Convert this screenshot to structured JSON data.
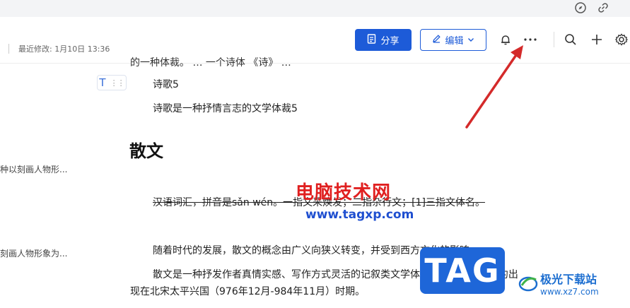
{
  "header": {
    "last_modified": "最近修改: 1月10日 13:36",
    "share_label": "分享",
    "edit_label": "编辑"
  },
  "sidebar": {
    "items": [
      {
        "label": "种以刻画人物形..."
      },
      {
        "label": "刻画人物形象为..."
      }
    ]
  },
  "document": {
    "cut_top_text": "的一种体裁。  …  一个诗体  《诗》  …",
    "block_handle_label": "T",
    "poem_title": "诗歌5",
    "poem_desc": "诗歌是一种抒情言志的文学体裁5",
    "section_heading": "散文",
    "struck_para": "汉语词汇，拼音是sǎn wén。一指文采焕发；二指杂行文；[1]三指文体名。",
    "para_1": "随着时代的发展，散文的概念由广义向狭义转变，并受到西方文化的影响。",
    "para_2": "散文是一种抒发作者真情实感、写作方式灵活的记叙类文学体裁。\"散文\"一词大约出",
    "para_3": "现在北宋太平兴国（976年12月-984年11月）时期。"
  },
  "watermarks": {
    "site_cn": "电脑技术网",
    "site_url": "www.tagxp.com",
    "tag_label": "TAG",
    "logo_name": "极光下载站",
    "logo_url": "www.xz7.com"
  },
  "colors": {
    "accent": "#1d5bd8",
    "annotation_arrow": "#d42a2a"
  },
  "icons": [
    "compass-icon",
    "link-icon",
    "document-icon",
    "pencil-icon",
    "chevron-down-icon",
    "bell-icon",
    "more-icon",
    "search-icon",
    "plus-icon",
    "gear-icon"
  ]
}
